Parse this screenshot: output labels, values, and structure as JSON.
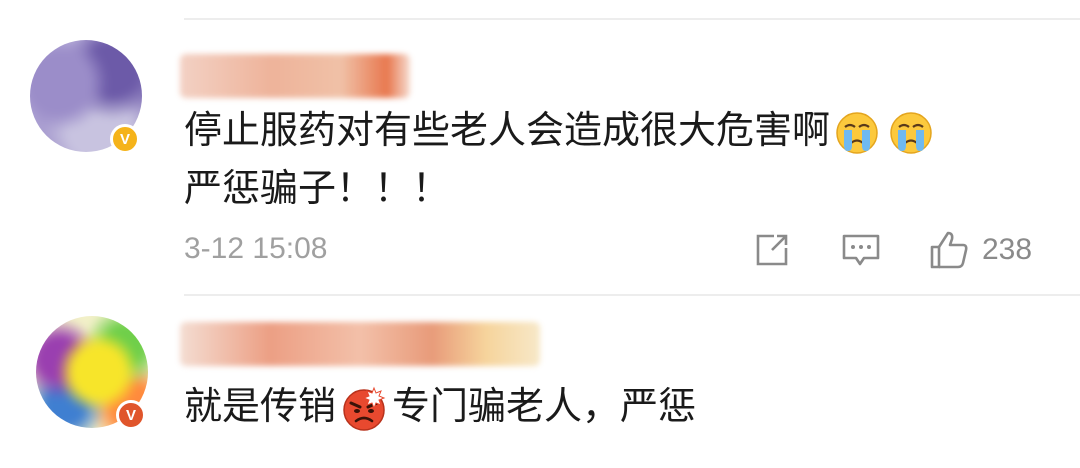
{
  "comments": [
    {
      "text_line1": "停止服药对有些老人会造成很大危害啊",
      "text_line2": "严惩骗子！！！",
      "emojis_line1": [
        "crying-face-emoji",
        "crying-face-emoji"
      ],
      "timestamp": "3-12 15:08",
      "like_count": "238",
      "badge_color": "#f5b31a"
    },
    {
      "text_before_emoji": "就是传销",
      "emoji": "angry-face-emoji",
      "text_after_emoji": "专门骗老人，严惩",
      "badge_color": "#e0552b"
    }
  ],
  "colors": {
    "text": "#1a1a1a",
    "meta": "#a0a0a0",
    "icon": "#8a8a8a",
    "divider": "#ededed"
  }
}
